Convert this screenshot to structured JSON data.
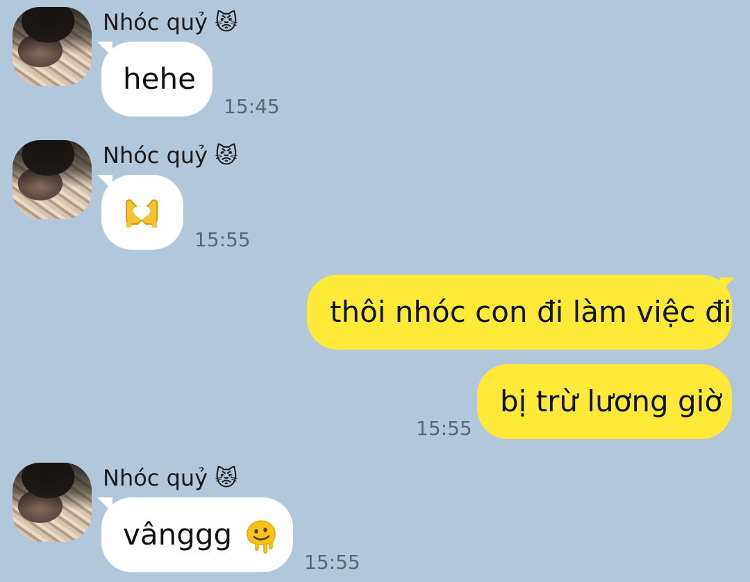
{
  "contact": {
    "name": "Nhóc quỷ",
    "name_emoji": "😾"
  },
  "messages": [
    {
      "direction": "incoming",
      "text": "hehe",
      "time": "15:45"
    },
    {
      "direction": "incoming",
      "sticker": "heart-hands",
      "time": "15:55"
    },
    {
      "direction": "outgoing",
      "text": "thôi nhóc con đi làm việc đi",
      "time": ""
    },
    {
      "direction": "outgoing",
      "text": "bị trừ lương giờ",
      "time": "15:55"
    },
    {
      "direction": "incoming",
      "text": "vânggg",
      "emoji": "melting-face",
      "time": "15:55"
    }
  ],
  "colors": {
    "background": "#b2c7da",
    "incoming_bubble": "#ffffff",
    "outgoing_bubble": "#fee838",
    "timestamp": "#5b6673"
  }
}
